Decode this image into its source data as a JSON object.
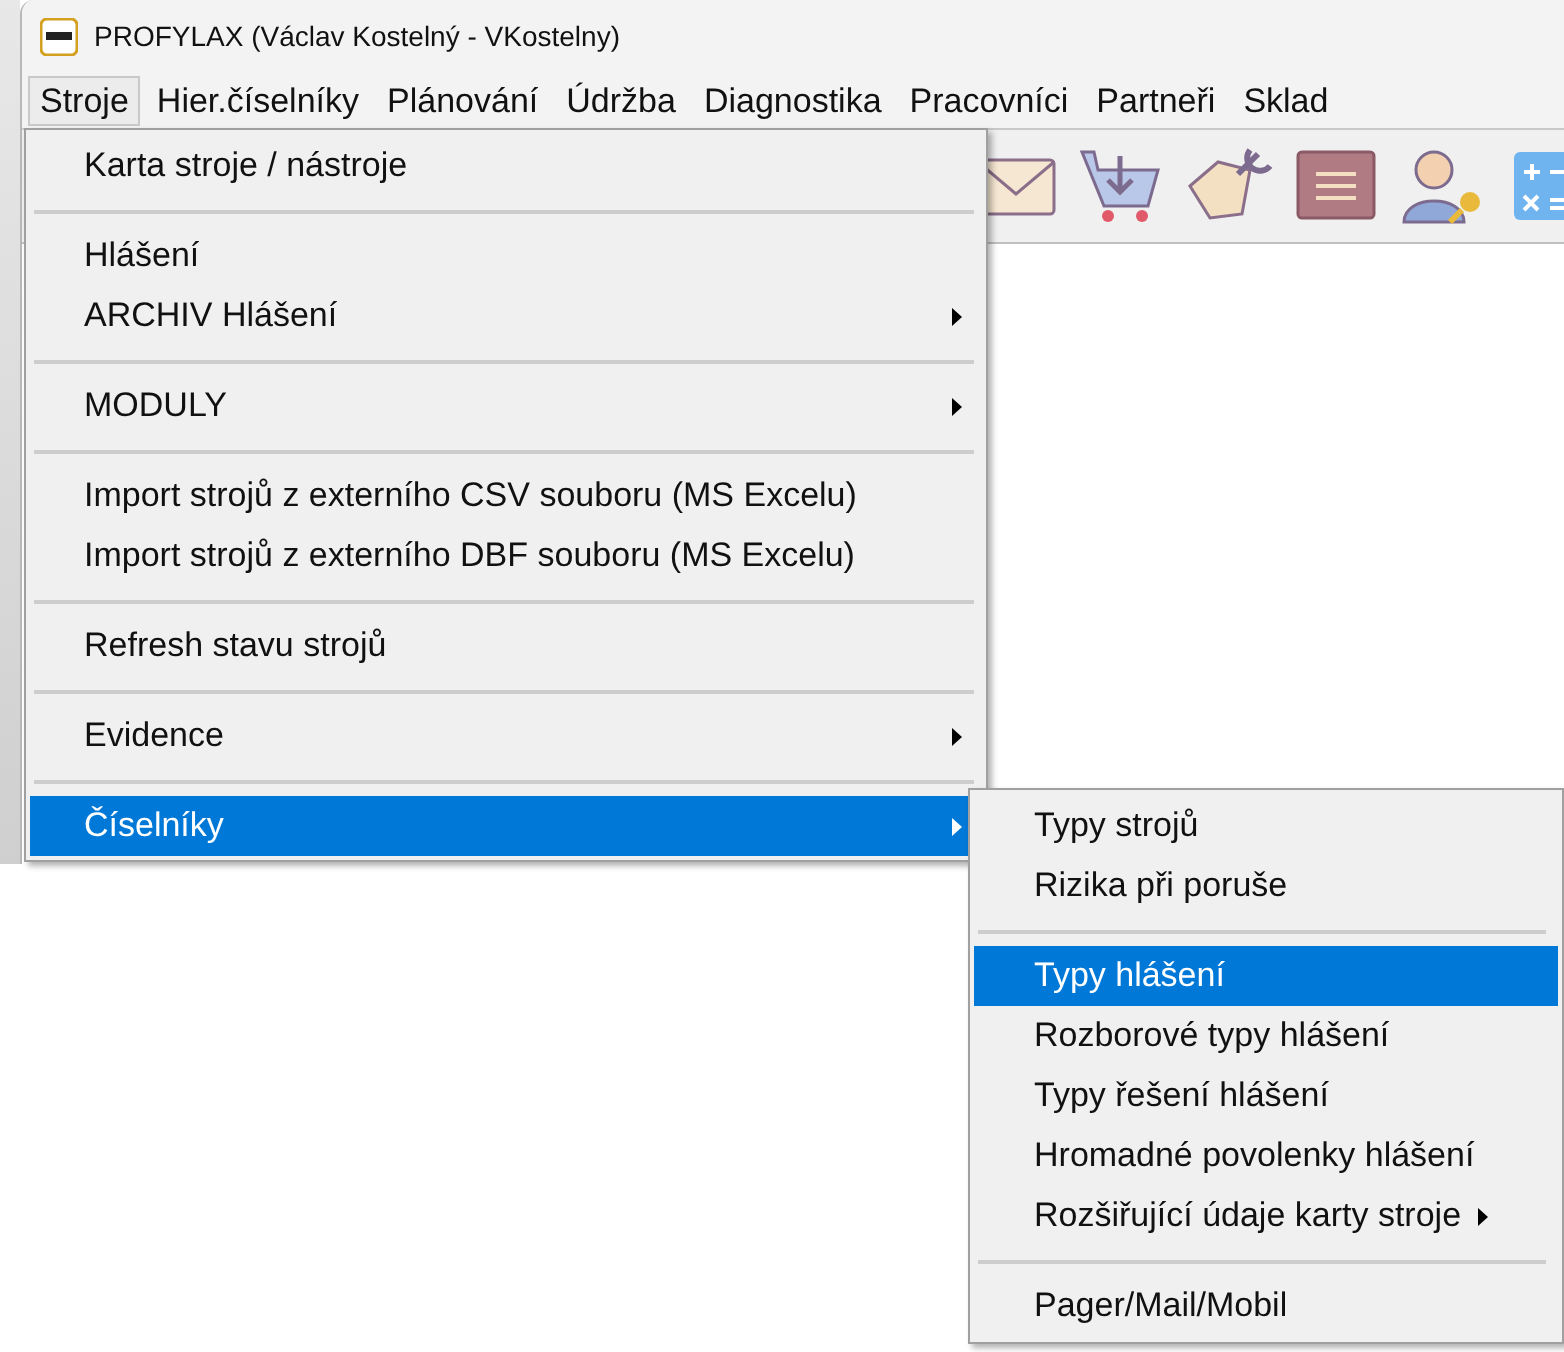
{
  "window": {
    "title": "PROFYLAX (Václav Kostelný - VKostelny)"
  },
  "menubar": [
    {
      "label": "Stroje",
      "selected": true
    },
    {
      "label": "Hier.číselníky",
      "selected": false
    },
    {
      "label": "Plánování",
      "selected": false
    },
    {
      "label": "Údržba",
      "selected": false
    },
    {
      "label": "Diagnostika",
      "selected": false
    },
    {
      "label": "Pracovníci",
      "selected": false
    },
    {
      "label": "Partneři",
      "selected": false
    },
    {
      "label": "Sklad",
      "selected": false
    }
  ],
  "dropdown": [
    {
      "kind": "item",
      "label": "Karta stroje / nástroje",
      "submenu": false,
      "selected": false
    },
    {
      "kind": "separator"
    },
    {
      "kind": "item",
      "label": "Hlášení",
      "submenu": false,
      "selected": false
    },
    {
      "kind": "item",
      "label": "ARCHIV Hlášení",
      "submenu": true,
      "selected": false
    },
    {
      "kind": "separator"
    },
    {
      "kind": "item",
      "label": "MODULY",
      "submenu": true,
      "selected": false
    },
    {
      "kind": "separator"
    },
    {
      "kind": "item",
      "label": "Import strojů z externího CSV souboru (MS Excelu)",
      "submenu": false,
      "selected": false
    },
    {
      "kind": "item",
      "label": "Import strojů z externího DBF souboru (MS Excelu)",
      "submenu": false,
      "selected": false
    },
    {
      "kind": "separator"
    },
    {
      "kind": "item",
      "label": "Refresh stavu strojů",
      "submenu": false,
      "selected": false
    },
    {
      "kind": "separator"
    },
    {
      "kind": "item",
      "label": "Evidence",
      "submenu": true,
      "selected": false
    },
    {
      "kind": "separator"
    },
    {
      "kind": "item",
      "label": "Číselníky",
      "submenu": true,
      "selected": true
    }
  ],
  "submenu": [
    {
      "kind": "item",
      "label": "Typy strojů",
      "submenu": false,
      "selected": false
    },
    {
      "kind": "item",
      "label": "Rizika při poruše",
      "submenu": false,
      "selected": false
    },
    {
      "kind": "separator"
    },
    {
      "kind": "item",
      "label": "Typy hlášení",
      "submenu": false,
      "selected": true
    },
    {
      "kind": "item",
      "label": "Rozborové typy hlášení",
      "submenu": false,
      "selected": false
    },
    {
      "kind": "item",
      "label": "Typy řešení hlášení",
      "submenu": false,
      "selected": false
    },
    {
      "kind": "item",
      "label": "Hromadné povolenky hlášení",
      "submenu": false,
      "selected": false
    },
    {
      "kind": "item",
      "label": "Rozšiřující údaje karty stroje",
      "submenu": true,
      "selected": false
    },
    {
      "kind": "separator"
    },
    {
      "kind": "item",
      "label": "Pager/Mail/Mobil",
      "submenu": false,
      "selected": false
    }
  ]
}
